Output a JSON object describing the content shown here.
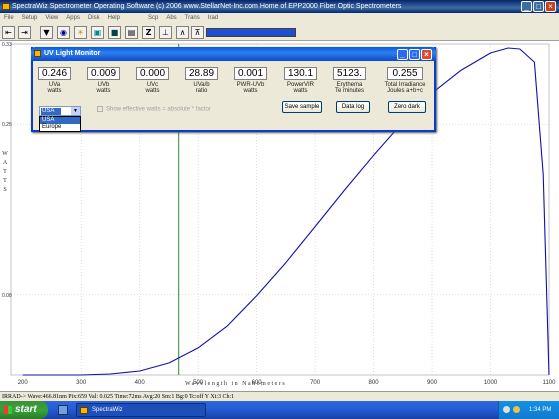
{
  "window": {
    "title": "SpectraWiz  Spectrometer Operating Software (c) 2006  www.StellarNet-Inc.com  Home of EPP2000 Fiber Optic Spectrometers"
  },
  "menu": [
    "File",
    "Setup",
    "View",
    "Apps",
    "Disk",
    "Help",
    "Scp",
    "Abs",
    "Trans",
    "Irad"
  ],
  "toolbar": {
    "icons": [
      "skip-start-icon",
      "skip-end-icon",
      "arrow-down-icon",
      "lens-icon",
      "bulb-icon",
      "camera-icon",
      "disk-icon",
      "print-icon",
      "z-icon",
      "baseline-icon",
      "peak-icon",
      "peak-label-icon"
    ]
  },
  "plot": {
    "ylabel_letters": [
      "W",
      "A",
      "T",
      "T",
      "S"
    ],
    "xlabel": "Wavelength in Nanometers",
    "y_ticks": [
      {
        "label": "0.33",
        "value": 0.33
      },
      {
        "label": "0.25",
        "value": 0.25
      },
      {
        "label": "0.08",
        "value": 0.08
      }
    ],
    "x_ticks": [
      "200",
      "300",
      "400",
      "500",
      "600",
      "700",
      "800",
      "900",
      "1000",
      "1100"
    ]
  },
  "chart_data": {
    "type": "line",
    "title": "",
    "xlabel": "Wavelength in Nanometers",
    "ylabel": "WATTS",
    "xlim": [
      180,
      1100
    ],
    "ylim": [
      0,
      0.33
    ],
    "grid": true,
    "cursor_x": 466.81,
    "series": [
      {
        "color": "#1010b0",
        "x": [
          200,
          300,
          350,
          400,
          450,
          500,
          550,
          600,
          650,
          700,
          750,
          800,
          850,
          900,
          950,
          1000,
          1030,
          1050,
          1075,
          1090,
          1100
        ],
        "y": [
          0.0,
          0.0,
          0.001,
          0.004,
          0.012,
          0.027,
          0.049,
          0.079,
          0.112,
          0.148,
          0.184,
          0.219,
          0.252,
          0.281,
          0.304,
          0.321,
          0.326,
          0.325,
          0.312,
          0.2,
          0.0
        ]
      }
    ]
  },
  "uv_monitor": {
    "title": "UV Light Monitor",
    "meters": [
      {
        "value": "0.246",
        "name": "UVa",
        "unit": "watts"
      },
      {
        "value": "0.009",
        "name": "UVb",
        "unit": "watts"
      },
      {
        "value": "0.000",
        "name": "UVc",
        "unit": "watts"
      },
      {
        "value": "28.89",
        "name": "UVa/b",
        "unit": "ratio"
      },
      {
        "value": "0.001",
        "name": "PWR-UVb",
        "unit": "watts"
      },
      {
        "value": "130.1",
        "name": "PowerVIR",
        "unit": "watts"
      },
      {
        "value": "5123.",
        "name": "Erythema",
        "unit": "Te  minutes"
      },
      {
        "value": "0.255",
        "name": "Total Irradiance",
        "unit": "Joules  a+b+c"
      }
    ],
    "region_selected": "USA",
    "region_options": [
      "USA",
      "Europe"
    ],
    "show_effective": "Show effective watts = absolute * factor",
    "buttons": {
      "save": "Save sample",
      "datalog": "Data log",
      "zero": "Zero dark"
    }
  },
  "status": {
    "text": "IRRAD-> Wave:466.81nm  Pix:659  Val:  0.025  Time:72ms  Avg:20  Sm:1  Bg:0  Tc:off Y  Xt:3  Ch:1"
  },
  "taskbar": {
    "start": "start",
    "task": "SpectraWiz",
    "clock": "1:34 PM"
  }
}
